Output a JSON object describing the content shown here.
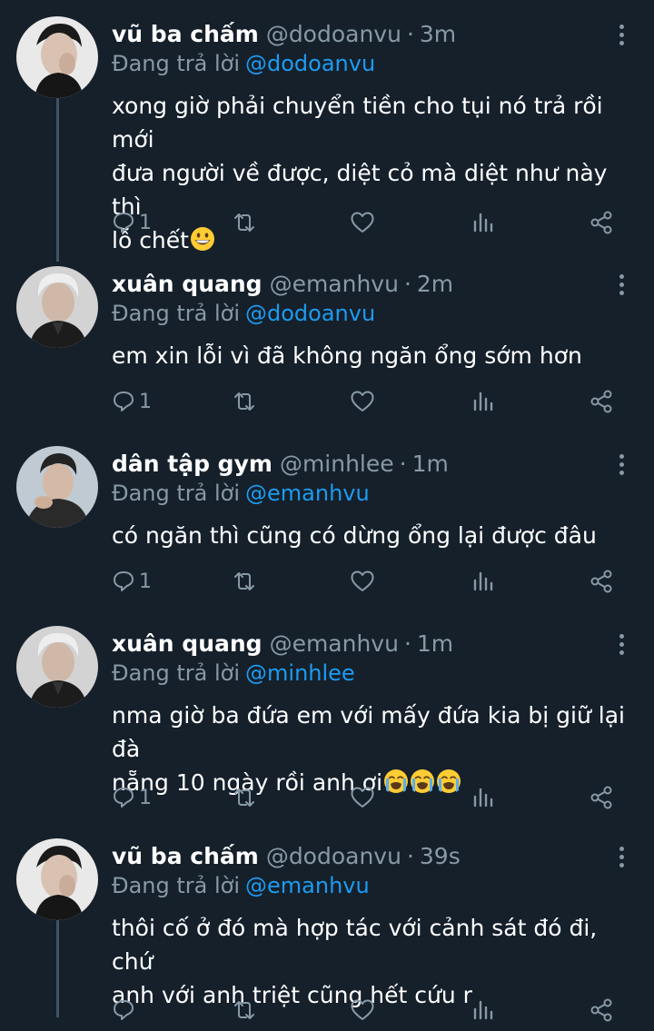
{
  "theme": {
    "background": "#15202b",
    "text": "#ffffff",
    "muted": "#8899a6",
    "link": "#1d9bf0",
    "thread_line": "#3d5466"
  },
  "icons": {
    "reply": "reply-icon",
    "retweet": "retweet-icon",
    "like": "heart-icon",
    "stats": "stats-icon",
    "share": "share-icon",
    "more": "more-icon"
  },
  "tweets": [
    {
      "name": "vũ ba chấm",
      "handle": "@dodoanvu",
      "time": "3m",
      "reply_prefix": "Đang trả lời",
      "reply_to": "@dodoanvu",
      "text": "xong giờ phải chuyển tiền cho tụi nó trả rồi mới\nđưa người về được, diệt cỏ mà diệt như này thì\nlỗ chết",
      "emojis": [
        "grinning-face"
      ],
      "reply_count": "1"
    },
    {
      "name": "xuân quang",
      "handle": "@emanhvu",
      "time": "2m",
      "reply_prefix": "Đang trả lời",
      "reply_to": "@dodoanvu",
      "text": "em xin lỗi vì đã không ngăn ổng sớm hơn",
      "emojis": [],
      "reply_count": "1"
    },
    {
      "name": "dân tập gym",
      "handle": "@minhlee",
      "time": "1m",
      "reply_prefix": "Đang trả lời",
      "reply_to": "@emanhvu",
      "text": "có ngăn thì cũng có dừng ổng lại được đâu",
      "emojis": [],
      "reply_count": "1"
    },
    {
      "name": "xuân quang",
      "handle": "@emanhvu",
      "time": "1m",
      "reply_prefix": "Đang trả lời",
      "reply_to": "@minhlee",
      "text": "nma giờ ba đứa em với mấy đứa kia bị giữ lại đà\nnẵng 10 ngày rồi anh ơi",
      "emojis": [
        "loudly-crying-face",
        "loudly-crying-face",
        "loudly-crying-face"
      ],
      "reply_count": "1"
    },
    {
      "name": "vũ ba chấm",
      "handle": "@dodoanvu",
      "time": "39s",
      "reply_prefix": "Đang trả lời",
      "reply_to": "@emanhvu",
      "text": "thôi cố ở đó mà hợp tác với cảnh sát đó đi, chứ\nanh với anh triệt cũng hết cứu r",
      "emojis": [],
      "reply_count": ""
    }
  ]
}
